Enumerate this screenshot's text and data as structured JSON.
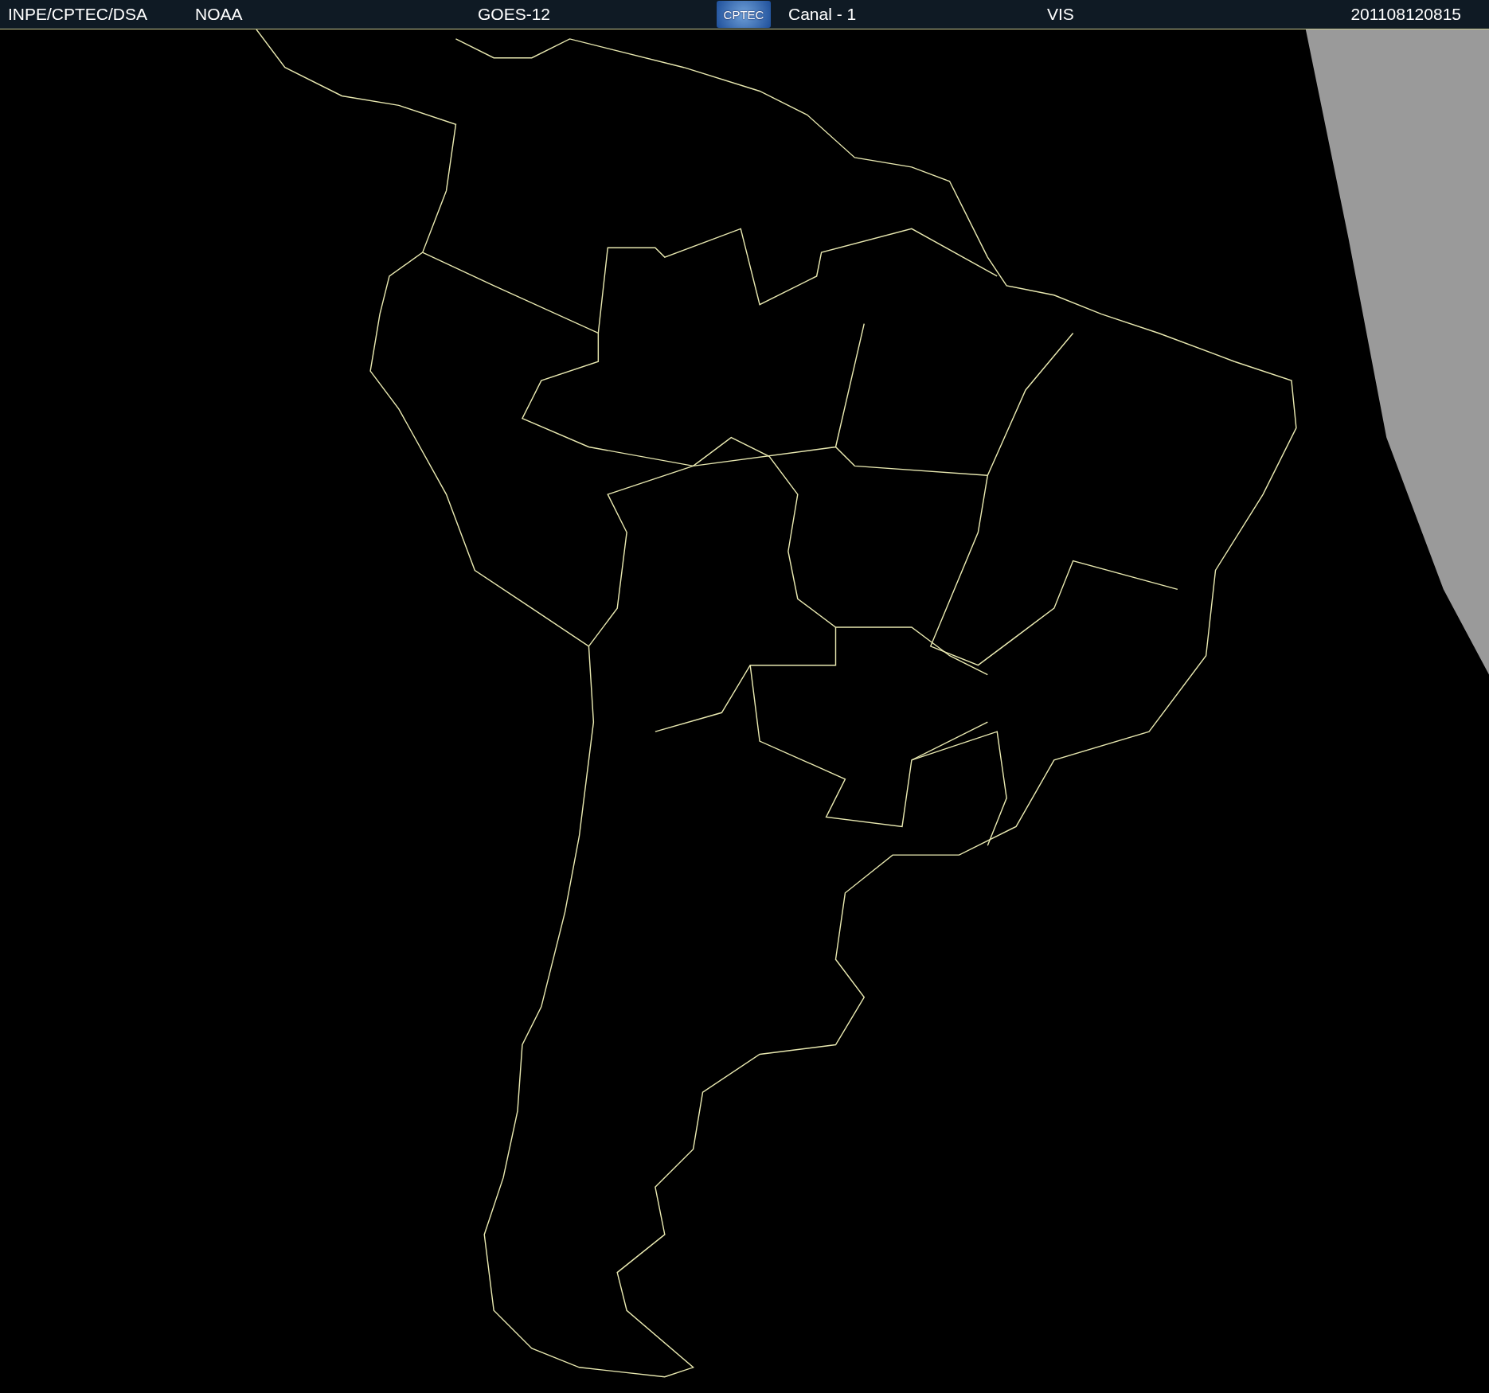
{
  "header": {
    "source": "INPE/CPTEC/DSA",
    "agency": "NOAA",
    "satellite": "GOES-12",
    "logo": "CPTEC",
    "channel": "Canal - 1",
    "band": "VIS",
    "timestamp": "201108120815"
  }
}
